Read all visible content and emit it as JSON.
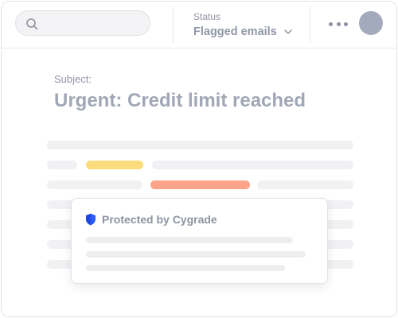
{
  "header": {
    "search": {
      "value": "",
      "placeholder": ""
    },
    "status": {
      "label": "Status",
      "value": "Flagged emails"
    }
  },
  "email": {
    "subject_label": "Subject:",
    "subject": "Urgent: Credit limit reached"
  },
  "security_popup": {
    "title": "Protected by Cygrade",
    "icon": "shield-icon"
  },
  "colors": {
    "shield": "#2d5bff",
    "highlight_yellow": "#fadc7c",
    "highlight_orange": "#fba48a",
    "avatar": "#a3aabb"
  }
}
